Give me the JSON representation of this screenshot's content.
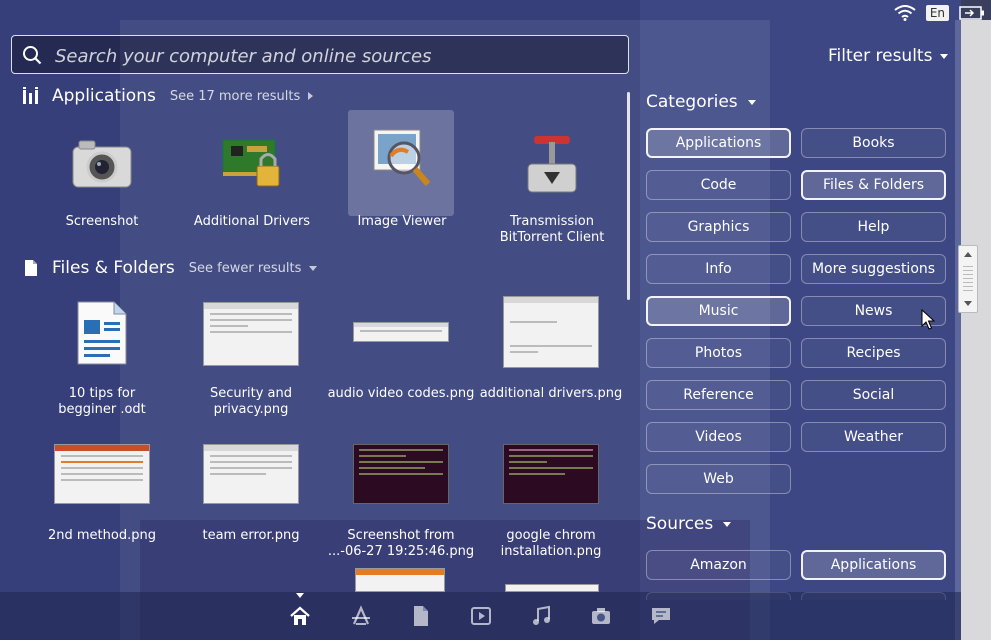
{
  "search": {
    "placeholder": "Search your computer and online sources"
  },
  "filter_results": {
    "label": "Filter results"
  },
  "panel": {
    "language": "En"
  },
  "applications": {
    "title": "Applications",
    "see_more": "See 17 more results",
    "items": [
      {
        "label": "Screenshot"
      },
      {
        "label": "Additional Drivers"
      },
      {
        "label": "Image Viewer"
      },
      {
        "label_line1": "Transmission",
        "label_line2": "BitTorrent Client"
      }
    ]
  },
  "files": {
    "title": "Files & Folders",
    "see_fewer": "See fewer results",
    "items": [
      {
        "line1": "10 tips for",
        "line2": "begginer .odt"
      },
      {
        "line1": "Security and",
        "line2": "privacy.png"
      },
      {
        "line1": "audio video codes.png",
        "line2": ""
      },
      {
        "line1": "additional drivers.png",
        "line2": ""
      },
      {
        "line1": "2nd method.png",
        "line2": ""
      },
      {
        "line1": "team error.png",
        "line2": ""
      },
      {
        "line1": "Screenshot from",
        "line2": "...-06-27 19:25:46.png"
      },
      {
        "line1": "google chrom",
        "line2": "installation.png"
      }
    ]
  },
  "categories": {
    "title": "Categories",
    "items": [
      {
        "label": "Applications",
        "active": true
      },
      {
        "label": "Books",
        "active": false
      },
      {
        "label": "Code",
        "active": false
      },
      {
        "label": "Files & Folders",
        "active": true
      },
      {
        "label": "Graphics",
        "active": false
      },
      {
        "label": "Help",
        "active": false
      },
      {
        "label": "Info",
        "active": false
      },
      {
        "label": "More suggestions",
        "active": false
      },
      {
        "label": "Music",
        "active": true
      },
      {
        "label": "News",
        "active": false
      },
      {
        "label": "Photos",
        "active": false
      },
      {
        "label": "Recipes",
        "active": false
      },
      {
        "label": "Reference",
        "active": false
      },
      {
        "label": "Social",
        "active": false
      },
      {
        "label": "Videos",
        "active": false
      },
      {
        "label": "Weather",
        "active": false
      },
      {
        "label": "Web",
        "active": false
      }
    ]
  },
  "sources": {
    "title": "Sources",
    "items": [
      {
        "label": "Amazon",
        "active": false
      },
      {
        "label": "Applications",
        "active": true
      }
    ]
  },
  "lens_bar": {
    "items": [
      "home-icon",
      "applications-icon",
      "files-icon",
      "video-icon",
      "music-icon",
      "photo-icon",
      "social-icon"
    ],
    "active": "home-icon"
  }
}
